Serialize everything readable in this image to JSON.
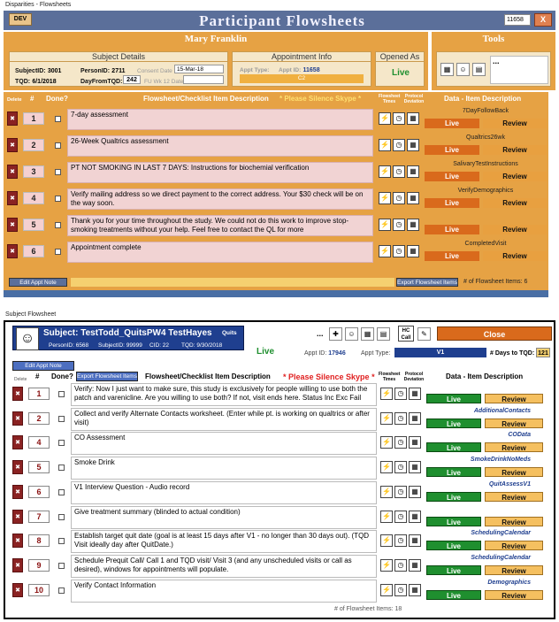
{
  "window1": {
    "titlebar": "Disparities - Flowsheets",
    "dev_label": "DEV",
    "title": "Participant Flowsheets",
    "person_box": "11658",
    "close_x": "X",
    "participant_name": "Mary Franklin",
    "subject_details": {
      "title": "Subject Details",
      "subjectid_label": "SubjectID:",
      "subjectid": "3001",
      "personid_label": "PersonID:",
      "personid": "2711",
      "consent_label": "Consent Date",
      "consent_date": "15-Mar-18",
      "tqd_label": "TQD:",
      "tqd": "6/1/2018",
      "dayfrom_label": "DayFromTQD:",
      "dayfrom": "242",
      "fuwk_label": "FU Wk 12 Date",
      "fuwk": ""
    },
    "appointment_info": {
      "title": "Appointment Info",
      "appt_type_label": "Appt Type:",
      "appt_id_label": "Appt ID:",
      "appt_id": "11658",
      "appt_type": "C2"
    },
    "opened_as": {
      "title": "Opened As",
      "value": "Live"
    },
    "tools": {
      "title": "Tools",
      "more": "..."
    },
    "columns": {
      "delete": "Delete",
      "num": "#",
      "done": "Done?",
      "desc": "Flowsheet/Checklist Item Description",
      "skype": "* Please Silence Skype *",
      "times": "Flowsheet Times",
      "deviation": "Protocol Deviation",
      "data": "Data - Item Description"
    },
    "rows": [
      {
        "num": "1",
        "desc": "7-day assessment",
        "data": "7DayFollowBack",
        "live": "Live",
        "review": "Review"
      },
      {
        "num": "2",
        "desc": "26-Week Qualtrics assessment",
        "data": "Qualtrics26wk",
        "live": "Live",
        "review": "Review"
      },
      {
        "num": "3",
        "desc": "PT NOT SMOKING IN LAST 7 DAYS: Instructions for biochemial verification",
        "data": "SalivaryTestInstructions",
        "live": "Live",
        "review": "Review"
      },
      {
        "num": "4",
        "desc": "Verify mailing address so we direct payment to the correct address. Your $30 check will be on the way soon.",
        "data": "VerifyDemographics",
        "live": "Live",
        "review": "Review"
      },
      {
        "num": "5",
        "desc": "Thank you for your time throughout the study. We could not do this work to improve stop-smoking treatments without your help. Feel free to contact the QL for more",
        "data": "",
        "live": "Live",
        "review": "Review"
      },
      {
        "num": "6",
        "desc": "Appointment complete",
        "data": "CompletedVisit",
        "live": "Live",
        "review": "Review"
      }
    ],
    "footer": {
      "edit_appt": "Edit Appt Note",
      "export": "Export Flowsheet Items",
      "count": "# of Flowsheet Items: 6"
    }
  },
  "window2": {
    "caption": "Subject Flowsheet",
    "subject_title": "Subject: TestTodd_QuitsPW4 TestHayes",
    "quits": "Quits",
    "personid": "PersonID: 6568",
    "subjectid": "SubjectID: 99999",
    "cid": "CID: 22",
    "tqd": "TQD: 9/30/2018",
    "live": "Live",
    "more": "...",
    "hc_call": "HC Call",
    "close": "Close",
    "appt_id_label": "Appt ID:",
    "appt_id": "17946",
    "appt_type_label": "Appt Type:",
    "appt_type": "V1",
    "days_label": "# Days to TQD:",
    "days": "121",
    "edit_appt": "Edit Appt Note",
    "export": "Export Flowsheet Items",
    "columns": {
      "delete": "Delete",
      "num": "#",
      "done": "Done?",
      "desc": "Flowsheet/Checklist Item Description",
      "skype": "* Please Silence Skype *",
      "times": "Flowsheet Times",
      "deviation": "Protocol Deviation",
      "data": "Data - Item Description"
    },
    "rows": [
      {
        "num": "1",
        "desc": "Verify: Now I just want to make sure, this study is exclusively for people willing to use both the patch and varenicline. Are you willing to use both? If not, visit ends here. Status Inc Exc Fail",
        "data": "",
        "live": "Live",
        "review": "Review"
      },
      {
        "num": "2",
        "desc": "Collect and verify Alternate Contacts worksheet. (Enter while pt. is working on qualtrics or after visit)",
        "data": "AdditionalContacts",
        "live": "Live",
        "review": "Review"
      },
      {
        "num": "4",
        "desc": "CO Assessment",
        "data": "COData",
        "live": "Live",
        "review": "Review"
      },
      {
        "num": "5",
        "desc": "Smoke Drink",
        "data": "SmokeDrinkNoMeds",
        "live": "Live",
        "review": "Review"
      },
      {
        "num": "6",
        "desc": "V1 Interview Question - Audio record",
        "data": "QuitAssessV1",
        "live": "Live",
        "review": "Review"
      },
      {
        "num": "7",
        "desc": "Give treatment summary (blinded to actual condition)",
        "data": "",
        "live": "Live",
        "review": "Review"
      },
      {
        "num": "8",
        "desc": "Establish target quit date (goal is at least 15 days after V1 - no longer than 30 days out). (TQD Visit ideally day after QuitDate.)",
        "data": "SchedulingCalendar",
        "live": "Live",
        "review": "Review"
      },
      {
        "num": "9",
        "desc": "Schedule Prequit Call/ Call 1 and TQD visit/ Visit 3 (and any unscheduled visits or call as desired), windows for appointments will populate.",
        "data": "SchedulingCalendar",
        "live": "Live",
        "review": "Review"
      },
      {
        "num": "10",
        "desc": "Verify Contact Information",
        "data": "Demographics",
        "live": "Live",
        "review": "Review"
      }
    ],
    "count": "# of Flowsheet Items: 18"
  }
}
